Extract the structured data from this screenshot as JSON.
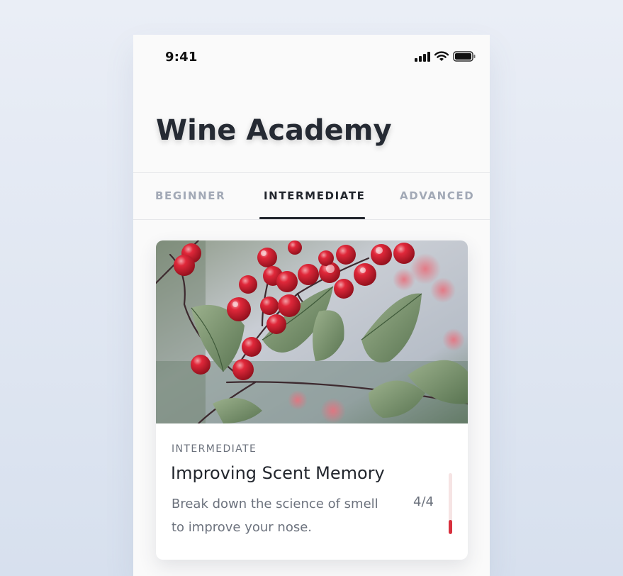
{
  "status_bar": {
    "time": "9:41",
    "icons": [
      "signal-icon",
      "wifi-icon",
      "battery-icon"
    ]
  },
  "header": {
    "title": "Wine Academy"
  },
  "tabs": [
    {
      "label": "BEGINNER",
      "active": false
    },
    {
      "label": "INTERMEDIATE",
      "active": true
    },
    {
      "label": "ADVANCED",
      "active": false
    }
  ],
  "course_card": {
    "image_icon": "red-berries-photo",
    "level": "INTERMEDIATE",
    "title": "Improving Scent Memory",
    "description": "Break down the science of smell to improve your nose.",
    "progress_text": "4/4",
    "progress_level": 0.23
  },
  "colors": {
    "accent": "#d8303d",
    "text_dark": "#22262d",
    "text_muted": "#6c727d",
    "tab_inactive": "#a2a9b6"
  }
}
